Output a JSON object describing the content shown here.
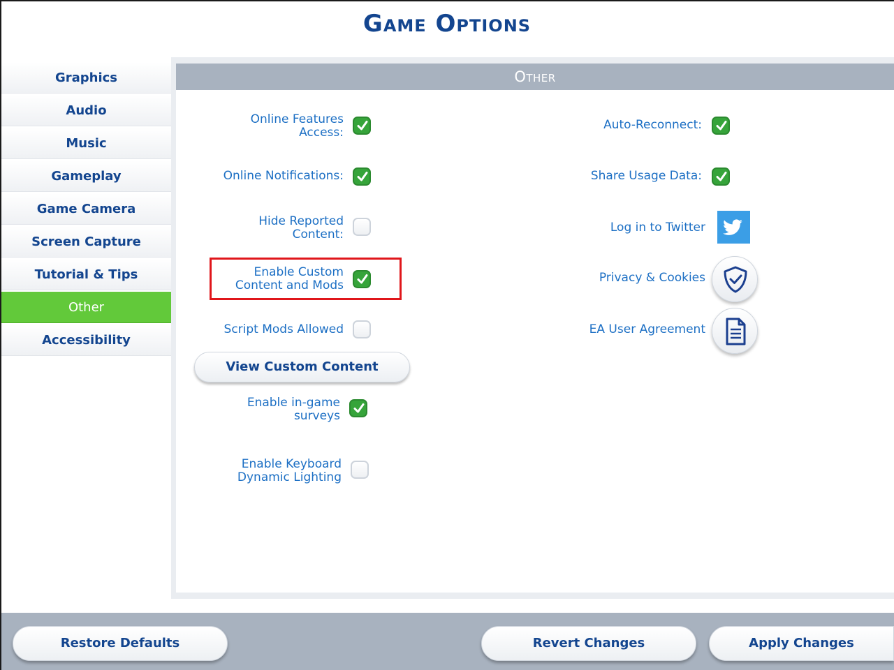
{
  "window": {
    "title": "Game Options"
  },
  "sidebar": {
    "items": [
      {
        "label": "Graphics"
      },
      {
        "label": "Audio"
      },
      {
        "label": "Music"
      },
      {
        "label": "Gameplay"
      },
      {
        "label": "Game Camera"
      },
      {
        "label": "Screen Capture"
      },
      {
        "label": "Tutorial & Tips"
      },
      {
        "label": "Other",
        "active": true
      },
      {
        "label": "Accessibility"
      }
    ]
  },
  "panel": {
    "header": "Other",
    "left_options": [
      {
        "label_line1": "Online Features",
        "label_line2": "Access:",
        "checked": true
      },
      {
        "label_line1": "Online Notifications:",
        "checked": true
      },
      {
        "label_line1": "Hide Reported",
        "label_line2": "Content:",
        "checked": false
      },
      {
        "label_line1": "Enable Custom",
        "label_line2": "Content and Mods",
        "checked": true,
        "highlighted": true
      },
      {
        "label_line1": "Script Mods Allowed",
        "checked": false
      },
      {
        "label_line1": "Enable in-game",
        "label_line2": "surveys",
        "checked": true
      },
      {
        "label_line1": "Enable Keyboard",
        "label_line2": "Dynamic Lighting",
        "checked": false
      }
    ],
    "view_custom_content_label": "View Custom Content",
    "right_options": [
      {
        "label": "Auto-Reconnect:",
        "checked": true
      },
      {
        "label": "Share Usage Data:",
        "checked": true
      }
    ],
    "links": {
      "twitter_label": "Log in to Twitter",
      "privacy_label": "Privacy & Cookies",
      "agreement_label": "EA User Agreement"
    }
  },
  "footer": {
    "restore_label": "Restore Defaults",
    "revert_label": "Revert Changes",
    "apply_label": "Apply Changes"
  },
  "colors": {
    "accent_blue": "#13458f",
    "label_blue": "#1c6fc4",
    "active_green": "#62c93a",
    "check_green": "#36a43a",
    "header_gray": "#a8b2bf",
    "highlight_red": "#e0161b",
    "twitter_blue": "#3b9ee6"
  }
}
